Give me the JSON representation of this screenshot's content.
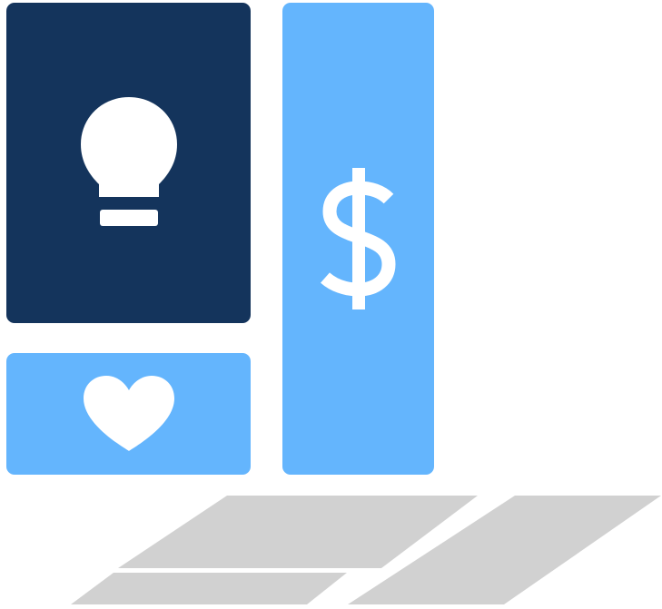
{
  "tiles": {
    "idea": {
      "icon": "lightbulb-icon",
      "color": "#14345c"
    },
    "love": {
      "icon": "heart-icon",
      "color": "#64b5fd"
    },
    "money": {
      "icon": "dollar-sign-icon",
      "color": "#64b5fd"
    }
  },
  "shadow": {
    "color": "#cfcfcf"
  },
  "icon_color": "#ffffff"
}
